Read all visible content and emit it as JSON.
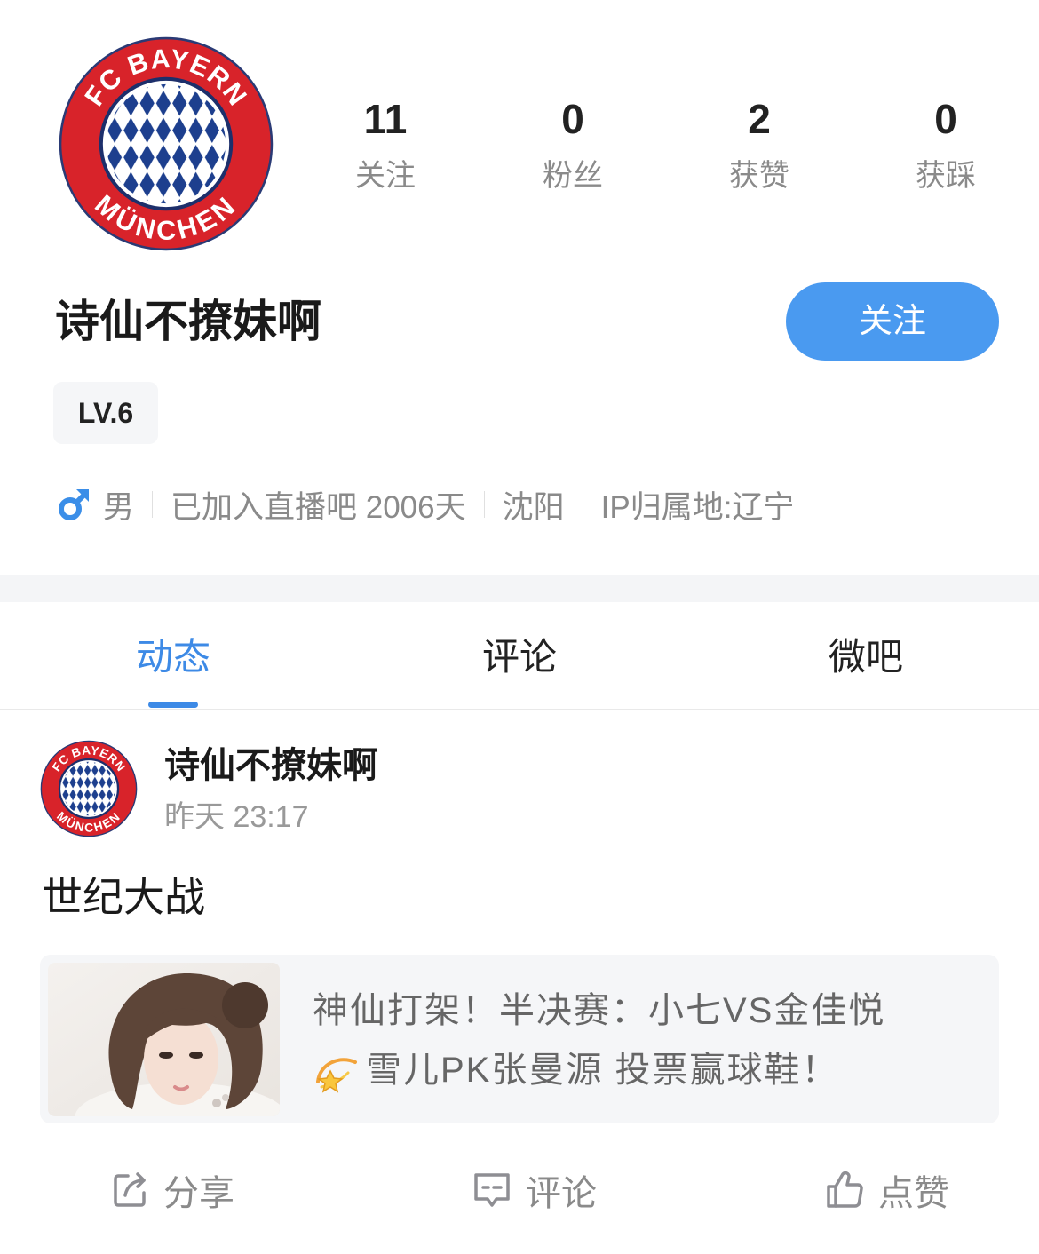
{
  "profile": {
    "avatar_logo": {
      "top_text": "FC BAYERN",
      "bottom_text": "MÜNCHEN"
    },
    "stats": [
      {
        "value": "11",
        "label": "关注"
      },
      {
        "value": "0",
        "label": "粉丝"
      },
      {
        "value": "2",
        "label": "获赞"
      },
      {
        "value": "0",
        "label": "获踩"
      }
    ],
    "username": "诗仙不撩妹啊",
    "follow_button": "关注",
    "level_badge": "LV.6",
    "info": {
      "gender_icon": "male-icon",
      "gender": "男",
      "joined": "已加入直播吧 2006天",
      "city": "沈阳",
      "ip_location": "IP归属地:辽宁"
    }
  },
  "tabs": [
    {
      "label": "动态",
      "active": true
    },
    {
      "label": "评论",
      "active": false
    },
    {
      "label": "微吧",
      "active": false
    }
  ],
  "post": {
    "author": "诗仙不撩妹啊",
    "time": "昨天 23:17",
    "content": "世纪大战",
    "link_card": {
      "thumbnail": "portrait-thumbnail",
      "title_line1": "神仙打架！半决赛：小七VS金佳悦",
      "title_line2_icon": "dizzy-emoji-icon",
      "title_line2": "雪儿PK张曼源 投票赢球鞋！"
    },
    "actions": [
      {
        "icon": "share-icon",
        "label": "分享"
      },
      {
        "icon": "comment-icon",
        "label": "评论"
      },
      {
        "icon": "thumbs-up-icon",
        "label": "点赞"
      }
    ]
  },
  "colors": {
    "accent": "#4a9af0",
    "tab_active": "#3d8ae6",
    "gender_male": "#3b8ee8",
    "text_secondary": "#8a8a8a",
    "card_bg": "#f5f6f8"
  }
}
